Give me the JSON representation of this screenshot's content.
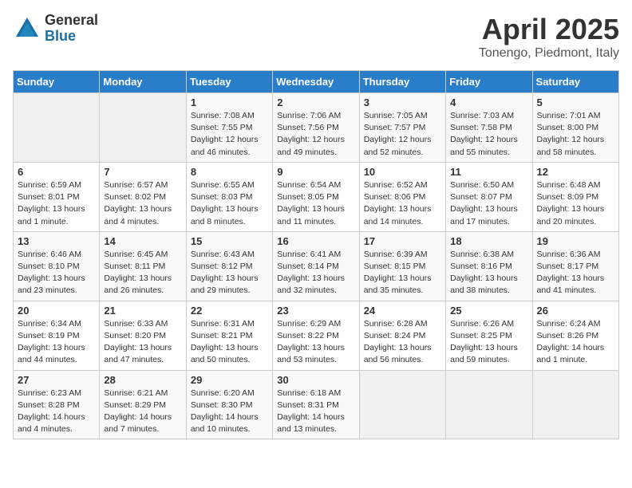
{
  "logo": {
    "general": "General",
    "blue": "Blue"
  },
  "header": {
    "month_title": "April 2025",
    "location": "Tonengo, Piedmont, Italy"
  },
  "days_of_week": [
    "Sunday",
    "Monday",
    "Tuesday",
    "Wednesday",
    "Thursday",
    "Friday",
    "Saturday"
  ],
  "weeks": [
    [
      {
        "day": "",
        "info": ""
      },
      {
        "day": "",
        "info": ""
      },
      {
        "day": "1",
        "info": "Sunrise: 7:08 AM\nSunset: 7:55 PM\nDaylight: 12 hours\nand 46 minutes."
      },
      {
        "day": "2",
        "info": "Sunrise: 7:06 AM\nSunset: 7:56 PM\nDaylight: 12 hours\nand 49 minutes."
      },
      {
        "day": "3",
        "info": "Sunrise: 7:05 AM\nSunset: 7:57 PM\nDaylight: 12 hours\nand 52 minutes."
      },
      {
        "day": "4",
        "info": "Sunrise: 7:03 AM\nSunset: 7:58 PM\nDaylight: 12 hours\nand 55 minutes."
      },
      {
        "day": "5",
        "info": "Sunrise: 7:01 AM\nSunset: 8:00 PM\nDaylight: 12 hours\nand 58 minutes."
      }
    ],
    [
      {
        "day": "6",
        "info": "Sunrise: 6:59 AM\nSunset: 8:01 PM\nDaylight: 13 hours\nand 1 minute."
      },
      {
        "day": "7",
        "info": "Sunrise: 6:57 AM\nSunset: 8:02 PM\nDaylight: 13 hours\nand 4 minutes."
      },
      {
        "day": "8",
        "info": "Sunrise: 6:55 AM\nSunset: 8:03 PM\nDaylight: 13 hours\nand 8 minutes."
      },
      {
        "day": "9",
        "info": "Sunrise: 6:54 AM\nSunset: 8:05 PM\nDaylight: 13 hours\nand 11 minutes."
      },
      {
        "day": "10",
        "info": "Sunrise: 6:52 AM\nSunset: 8:06 PM\nDaylight: 13 hours\nand 14 minutes."
      },
      {
        "day": "11",
        "info": "Sunrise: 6:50 AM\nSunset: 8:07 PM\nDaylight: 13 hours\nand 17 minutes."
      },
      {
        "day": "12",
        "info": "Sunrise: 6:48 AM\nSunset: 8:09 PM\nDaylight: 13 hours\nand 20 minutes."
      }
    ],
    [
      {
        "day": "13",
        "info": "Sunrise: 6:46 AM\nSunset: 8:10 PM\nDaylight: 13 hours\nand 23 minutes."
      },
      {
        "day": "14",
        "info": "Sunrise: 6:45 AM\nSunset: 8:11 PM\nDaylight: 13 hours\nand 26 minutes."
      },
      {
        "day": "15",
        "info": "Sunrise: 6:43 AM\nSunset: 8:12 PM\nDaylight: 13 hours\nand 29 minutes."
      },
      {
        "day": "16",
        "info": "Sunrise: 6:41 AM\nSunset: 8:14 PM\nDaylight: 13 hours\nand 32 minutes."
      },
      {
        "day": "17",
        "info": "Sunrise: 6:39 AM\nSunset: 8:15 PM\nDaylight: 13 hours\nand 35 minutes."
      },
      {
        "day": "18",
        "info": "Sunrise: 6:38 AM\nSunset: 8:16 PM\nDaylight: 13 hours\nand 38 minutes."
      },
      {
        "day": "19",
        "info": "Sunrise: 6:36 AM\nSunset: 8:17 PM\nDaylight: 13 hours\nand 41 minutes."
      }
    ],
    [
      {
        "day": "20",
        "info": "Sunrise: 6:34 AM\nSunset: 8:19 PM\nDaylight: 13 hours\nand 44 minutes."
      },
      {
        "day": "21",
        "info": "Sunrise: 6:33 AM\nSunset: 8:20 PM\nDaylight: 13 hours\nand 47 minutes."
      },
      {
        "day": "22",
        "info": "Sunrise: 6:31 AM\nSunset: 8:21 PM\nDaylight: 13 hours\nand 50 minutes."
      },
      {
        "day": "23",
        "info": "Sunrise: 6:29 AM\nSunset: 8:22 PM\nDaylight: 13 hours\nand 53 minutes."
      },
      {
        "day": "24",
        "info": "Sunrise: 6:28 AM\nSunset: 8:24 PM\nDaylight: 13 hours\nand 56 minutes."
      },
      {
        "day": "25",
        "info": "Sunrise: 6:26 AM\nSunset: 8:25 PM\nDaylight: 13 hours\nand 59 minutes."
      },
      {
        "day": "26",
        "info": "Sunrise: 6:24 AM\nSunset: 8:26 PM\nDaylight: 14 hours\nand 1 minute."
      }
    ],
    [
      {
        "day": "27",
        "info": "Sunrise: 6:23 AM\nSunset: 8:28 PM\nDaylight: 14 hours\nand 4 minutes."
      },
      {
        "day": "28",
        "info": "Sunrise: 6:21 AM\nSunset: 8:29 PM\nDaylight: 14 hours\nand 7 minutes."
      },
      {
        "day": "29",
        "info": "Sunrise: 6:20 AM\nSunset: 8:30 PM\nDaylight: 14 hours\nand 10 minutes."
      },
      {
        "day": "30",
        "info": "Sunrise: 6:18 AM\nSunset: 8:31 PM\nDaylight: 14 hours\nand 13 minutes."
      },
      {
        "day": "",
        "info": ""
      },
      {
        "day": "",
        "info": ""
      },
      {
        "day": "",
        "info": ""
      }
    ]
  ]
}
